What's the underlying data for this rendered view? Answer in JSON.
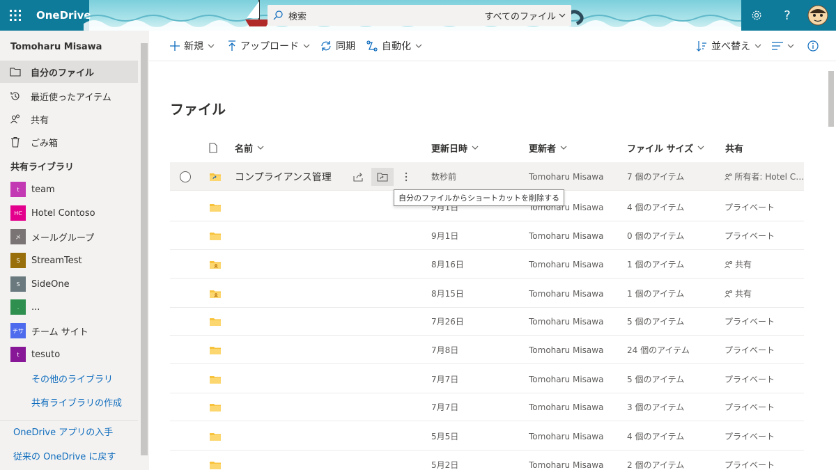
{
  "header": {
    "app_name": "OneDrive",
    "search_label": "検索",
    "search_scope": "すべてのファイル"
  },
  "nav": {
    "user": "Tomoharu Misawa",
    "items": [
      {
        "label": "自分のファイル",
        "icon": "folder-icon"
      },
      {
        "label": "最近使ったアイテム",
        "icon": "history-icon"
      },
      {
        "label": "共有",
        "icon": "people-icon"
      },
      {
        "label": "ごみ箱",
        "icon": "recycle-bin-icon"
      }
    ],
    "shared_libraries_heading": "共有ライブラリ",
    "libraries": [
      {
        "label": "team",
        "badge": "t",
        "color": "#c239b3"
      },
      {
        "label": "Hotel Contoso",
        "badge": "HC",
        "color": "#e3008c"
      },
      {
        "label": "メールグループ",
        "badge": "メ",
        "color": "#7a7574"
      },
      {
        "label": "StreamTest",
        "badge": "S",
        "color": "#986f0b"
      },
      {
        "label": "SideOne",
        "badge": "S",
        "color": "#69797e"
      },
      {
        "label": "...",
        "badge": ".",
        "color": "#2f8f4e"
      },
      {
        "label": "チーム サイト",
        "badge": "チサ",
        "color": "#4f6bed"
      },
      {
        "label": "tesuto",
        "badge": "t",
        "color": "#881798"
      }
    ],
    "more_libraries": "その他のライブラリ",
    "create_library": "共有ライブラリの作成",
    "get_app": "OneDrive アプリの入手",
    "classic": "従来の OneDrive に戻す"
  },
  "commands": {
    "new": "新規",
    "upload": "アップロード",
    "sync": "同期",
    "automate": "自動化",
    "sort": "並べ替え"
  },
  "main": {
    "title": "ファイル",
    "columns": {
      "name": "名前",
      "modified": "更新日時",
      "modified_by": "更新者",
      "size": "ファイル サイズ",
      "sharing": "共有"
    },
    "tooltip": "自分のファイルからショートカットを削除する",
    "rows": [
      {
        "name": "コンプライアンス管理",
        "modified": "数秒前",
        "by": "Tomoharu Misawa",
        "size": "7 個のアイテム",
        "sharing": "所有者: Hotel Co...",
        "folder": "shortcut",
        "share_icon": true
      },
      {
        "name": "",
        "modified": "9月1日",
        "by": "Tomoharu Misawa",
        "size": "4 個のアイテム",
        "sharing": "プライベート",
        "folder": "plain",
        "share_icon": false
      },
      {
        "name": "",
        "modified": "9月1日",
        "by": "Tomoharu Misawa",
        "size": "0 個のアイテム",
        "sharing": "プライベート",
        "folder": "plain",
        "share_icon": false
      },
      {
        "name": "",
        "modified": "8月16日",
        "by": "Tomoharu Misawa",
        "size": "1 個のアイテム",
        "sharing": "共有",
        "folder": "shared",
        "share_icon": true
      },
      {
        "name": "",
        "modified": "8月15日",
        "by": "Tomoharu Misawa",
        "size": "1 個のアイテム",
        "sharing": "共有",
        "folder": "shared",
        "share_icon": true
      },
      {
        "name": "",
        "modified": "7月26日",
        "by": "Tomoharu Misawa",
        "size": "5 個のアイテム",
        "sharing": "プライベート",
        "folder": "plain",
        "share_icon": false
      },
      {
        "name": "",
        "modified": "7月8日",
        "by": "Tomoharu Misawa",
        "size": "24 個のアイテム",
        "sharing": "プライベート",
        "folder": "plain",
        "share_icon": false
      },
      {
        "name": "",
        "modified": "7月7日",
        "by": "Tomoharu Misawa",
        "size": "5 個のアイテム",
        "sharing": "プライベート",
        "folder": "plain",
        "share_icon": false
      },
      {
        "name": "",
        "modified": "7月7日",
        "by": "Tomoharu Misawa",
        "size": "3 個のアイテム",
        "sharing": "プライベート",
        "folder": "plain",
        "share_icon": false
      },
      {
        "name": "",
        "modified": "5月5日",
        "by": "Tomoharu Misawa",
        "size": "4 個のアイテム",
        "sharing": "プライベート",
        "folder": "plain",
        "share_icon": false
      },
      {
        "name": "",
        "modified": "5月2日",
        "by": "Tomoharu Misawa",
        "size": "2 個のアイテム",
        "sharing": "プライベート",
        "folder": "plain",
        "share_icon": false
      }
    ]
  },
  "colors": {
    "brand": "#0f7b9a",
    "link": "#0f6cbd",
    "folder": "#f8c33c"
  }
}
